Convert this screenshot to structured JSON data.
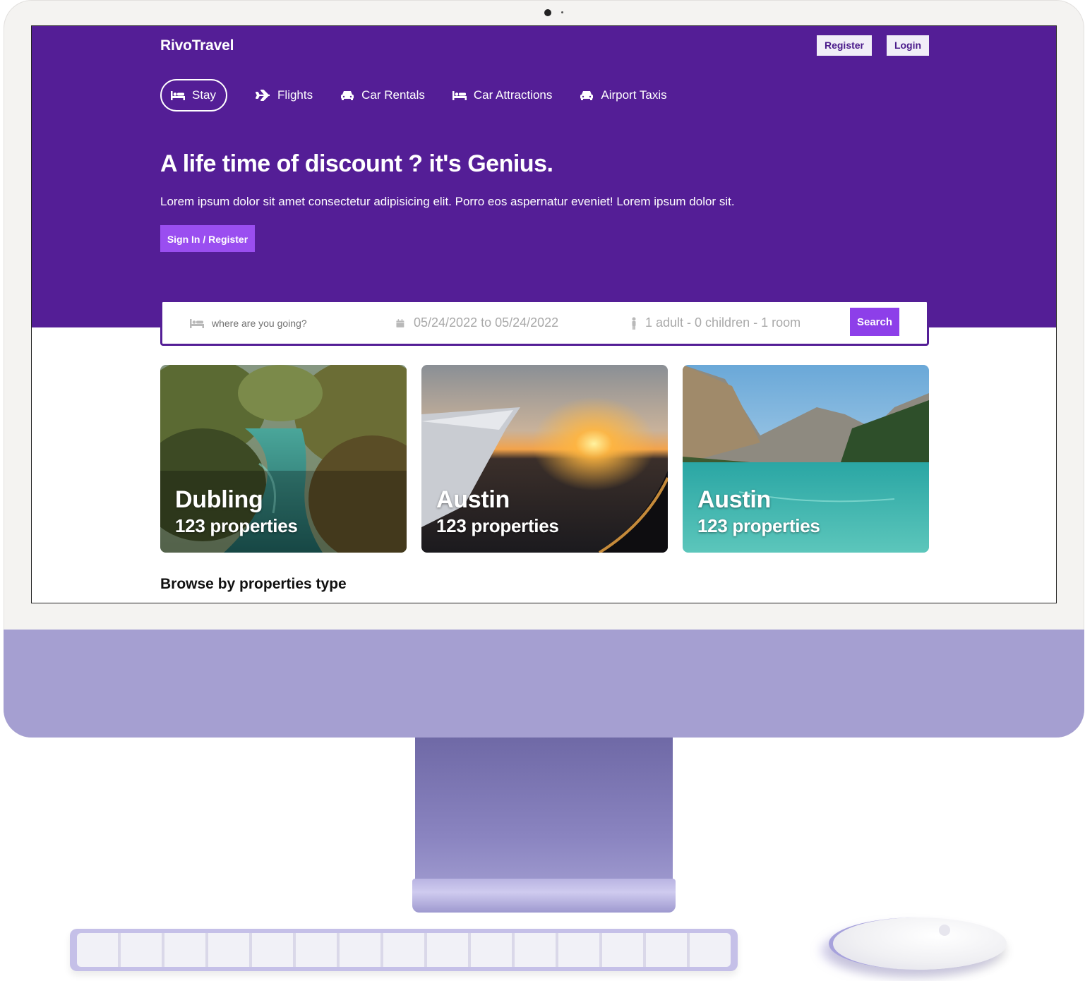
{
  "brand": "RivoTravel",
  "header": {
    "register_label": "Register",
    "login_label": "Login"
  },
  "nav": {
    "items": [
      {
        "label": "Stay",
        "icon": "bed-icon",
        "active": true
      },
      {
        "label": "Flights",
        "icon": "plane-icon",
        "active": false
      },
      {
        "label": "Car Rentals",
        "icon": "car-icon",
        "active": false
      },
      {
        "label": "Car Attractions",
        "icon": "bed-icon",
        "active": false
      },
      {
        "label": "Airport Taxis",
        "icon": "car-icon",
        "active": false
      }
    ]
  },
  "hero": {
    "headline": "A life time of discount ? it's Genius.",
    "lead": "Lorem ipsum dolor sit amet consectetur adipisicing elit. Porro eos aspernatur eveniet! Lorem ipsum dolor sit.",
    "cta_label": "Sign In / Register"
  },
  "search": {
    "destination_placeholder": "where are you going?",
    "dates": "05/24/2022 to 05/24/2022",
    "guests": "1 adult - 0 children - 1 room",
    "button_label": "Search"
  },
  "featured": [
    {
      "city": "Dubling",
      "properties": "123 properties"
    },
    {
      "city": "Austin",
      "properties": "123 properties"
    },
    {
      "city": "Austin",
      "properties": "123 properties"
    }
  ],
  "browse": {
    "title": "Browse by properties type"
  },
  "colors": {
    "hero_bg": "#541e96",
    "accent_button": "#9a4ef0",
    "search_button": "#8d3fe9",
    "device_chin": "#a59fd1"
  }
}
